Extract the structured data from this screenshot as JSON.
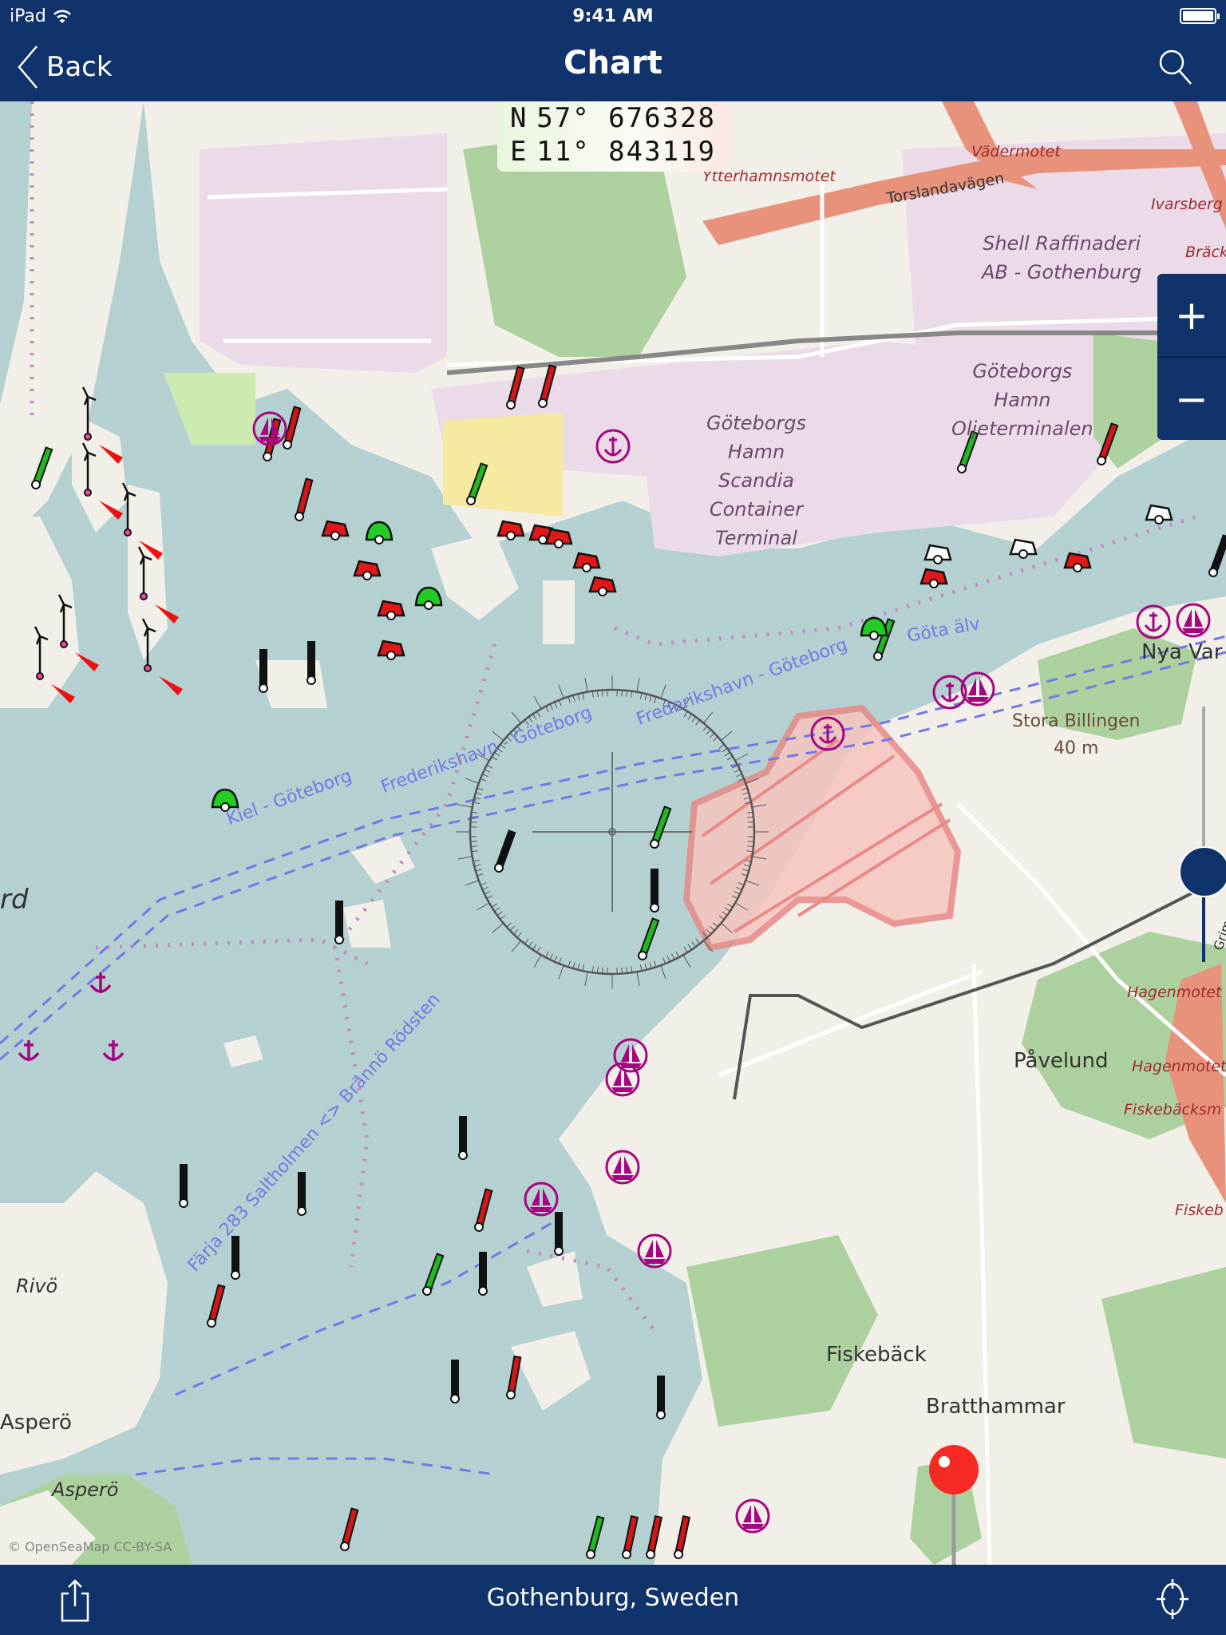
{
  "status_bar": {
    "carrier": "iPad",
    "time": "9:41 AM",
    "battery_level": 1.0
  },
  "nav": {
    "back_label": "Back",
    "title": "Chart",
    "search_icon": "search-icon"
  },
  "coordinates": {
    "lat_hemisphere": "N",
    "lat_value": "57° 676328",
    "lon_hemisphere": "E",
    "lon_value": "11° 843119"
  },
  "zoom_controls": {
    "zoom_in": "+",
    "zoom_out": "−"
  },
  "zoom_slider": {
    "level_fraction": 0.35
  },
  "map_labels": {
    "industrial": [
      {
        "id": "shell",
        "lines": [
          "Shell Raffinaderi",
          "AB - Gothenburg"
        ]
      },
      {
        "id": "oljeterminalen",
        "lines": [
          "Göteborgs",
          "Hamn",
          "Oljeterminalen"
        ]
      },
      {
        "id": "scandia",
        "lines": [
          "Göteborgs",
          "Hamn",
          "Scandia",
          "Container",
          "Terminal"
        ]
      }
    ],
    "roads": {
      "ytterhamnsmotet": "Ytterhamnsmotet",
      "vadermotet": "Vädermotet",
      "ivarsberg": "Ivarsberg",
      "brack": "Bräck",
      "torslandavagen": "Torslandavägen",
      "hagenmotet1": "Hagenmotet",
      "hagenmotet2": "Hagenmotet",
      "fiskebacksmotet": "Fiskebäcksm",
      "fiskeback_road": "Fiskeb",
      "grimstad": "Grimstadsg"
    },
    "places": {
      "nya_varvet": "Nya Var",
      "stora_billingen": "Stora Billingen",
      "stora_billingen_elev": "40 m",
      "pavelund": "Påvelund",
      "fiskeback": "Fiskebäck",
      "bratthammar": "Bratthammar",
      "rivo": "Rivö",
      "aspero1": "Asperö",
      "aspero2": "Asperö",
      "fjord": "rd"
    },
    "routes": {
      "kiel": "Kiel - Göteborg",
      "fred1": "Frederikshavn - Göteborg",
      "fred2": "Frederikshavn - Göteborg",
      "gota": "Göta älv",
      "farja": "Färja 283 Saltholmen <> Brännö Rödsten"
    }
  },
  "attribution": "© OpenSeaMap CC-BY-SA",
  "bottom_bar": {
    "location": "Gothenburg, Sweden",
    "share_icon": "share-icon",
    "locate_icon": "crosshair-icon"
  },
  "colors": {
    "bar": "#11336b",
    "water": "#b5d0d0",
    "industrial": "#ebdbe8",
    "land": "#f2efe9",
    "forest": "#add19e",
    "motorway": "#e8927c",
    "route": "#7477e6",
    "seamark_magenta": "#a5067f",
    "pin": "#f42a23"
  }
}
